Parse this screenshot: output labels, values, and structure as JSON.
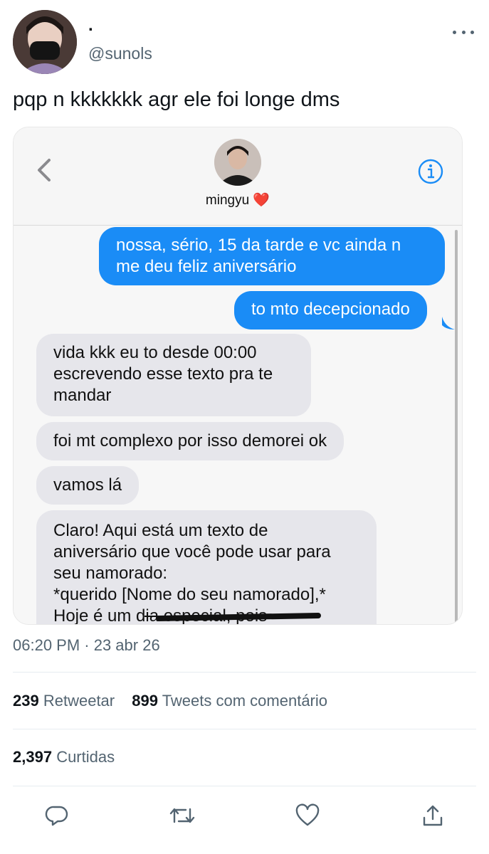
{
  "tweet": {
    "display_name": ".",
    "handle": "@sunols",
    "text": "pqp n kkkkkkk agr ele foi longe dms",
    "timestamp": "06:20 PM · 23 abr 26"
  },
  "embedded_chat": {
    "contact_name": "mingyu",
    "contact_emoji": "❤️",
    "messages": [
      {
        "side": "sent",
        "lines": [
          "nossa, sério, 15 da tarde e vc ainda n",
          "me deu feliz aniversário"
        ]
      },
      {
        "side": "sent",
        "lines": [
          "to mto decepcionado"
        ]
      },
      {
        "side": "received",
        "lines": [
          "vida kkk eu to desde 00:00",
          "escrevendo esse texto pra te",
          "mandar"
        ]
      },
      {
        "side": "received",
        "lines": [
          "foi mt complexo por isso demorei ok"
        ]
      },
      {
        "side": "received",
        "lines": [
          "vamos lá"
        ]
      },
      {
        "side": "received",
        "lines": [
          "Claro! Aqui está um texto de",
          "aniversário que você pode usar para",
          "seu namorado:",
          "*querido [Nome do seu namorado],*",
          "Hoje é um dia especial, pois"
        ]
      }
    ]
  },
  "stats": {
    "retweets_count": "239",
    "retweets_label": "Retweetar",
    "quotes_count": "899",
    "quotes_label": "Tweets com comentário",
    "likes_count": "2,397",
    "likes_label": "Curtidas"
  },
  "icons": {
    "more": "more-horizontal-icon",
    "back": "chevron-left-icon",
    "info": "info-icon",
    "reply": "reply-icon",
    "retweet": "retweet-icon",
    "like": "heart-icon",
    "share": "share-icon"
  },
  "colors": {
    "sent_bubble": "#1a8cf6",
    "received_bubble": "#e6e6eb",
    "secondary_text": "#536471",
    "info_blue": "#1a8cf6"
  }
}
